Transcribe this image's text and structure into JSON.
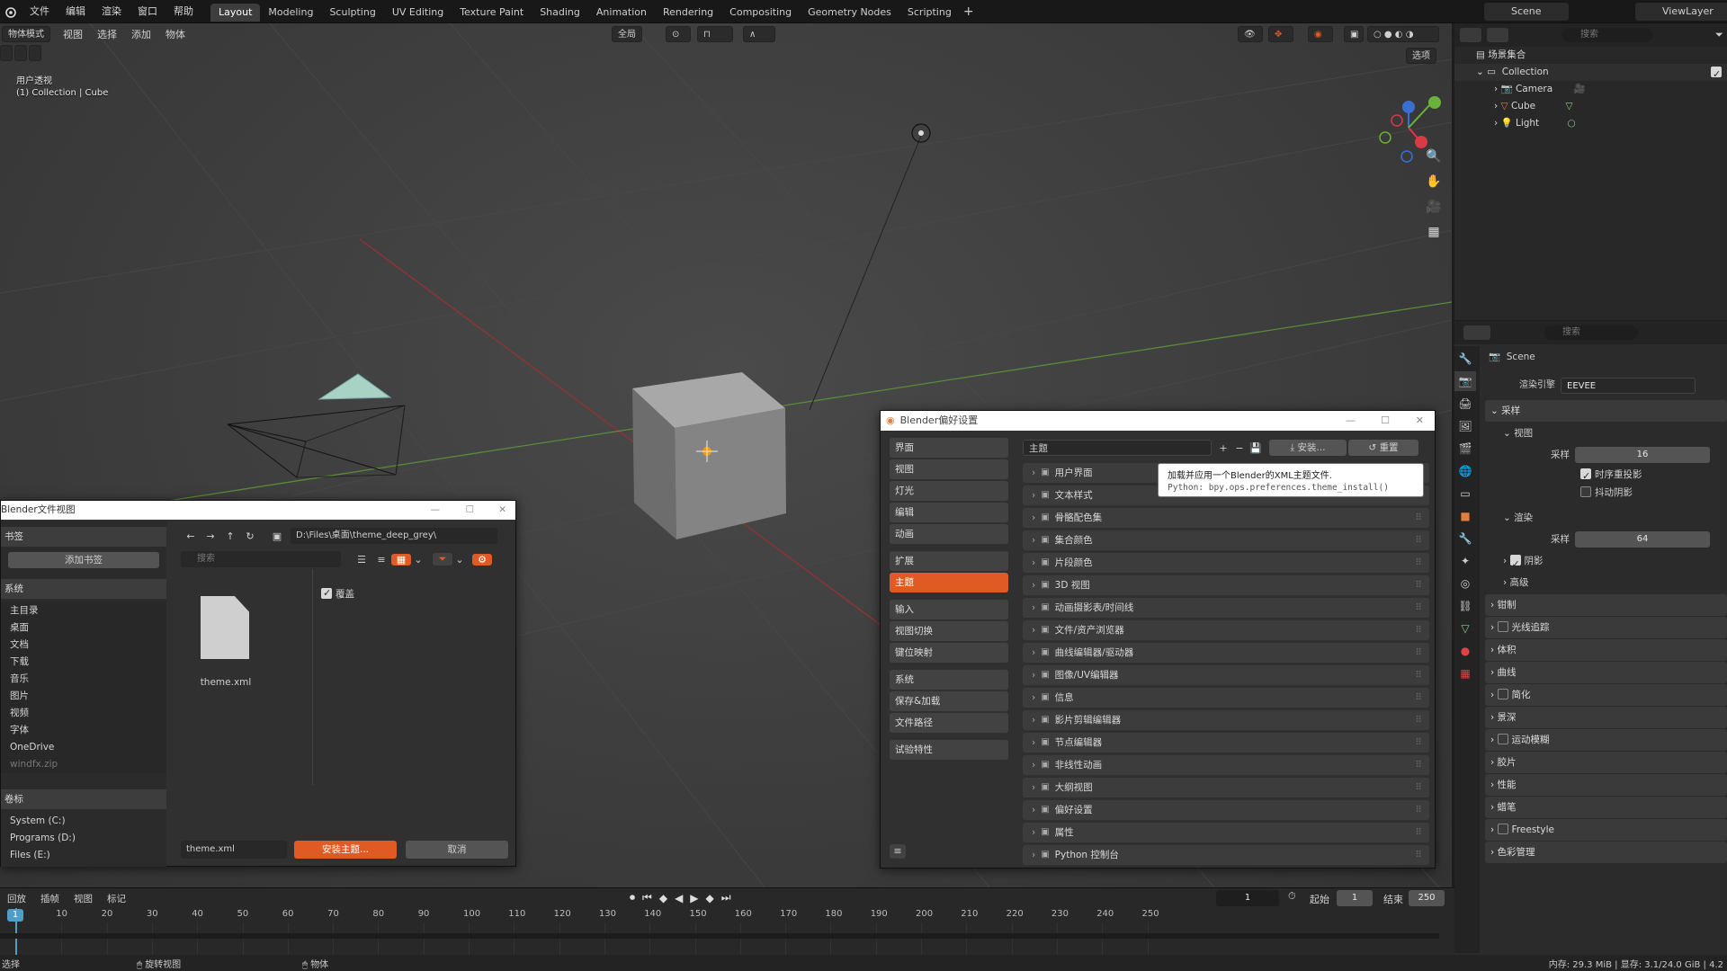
{
  "topbar": {
    "menus": [
      "文件",
      "编辑",
      "渲染",
      "窗口",
      "帮助"
    ],
    "workspaces": [
      "Layout",
      "Modeling",
      "Sculpting",
      "UV Editing",
      "Texture Paint",
      "Shading",
      "Animation",
      "Rendering",
      "Compositing",
      "Geometry Nodes",
      "Scripting"
    ],
    "active_workspace": "Layout",
    "scene": "Scene",
    "view_layer": "ViewLayer"
  },
  "viewport": {
    "mode": "物体模式",
    "menus": [
      "视图",
      "选择",
      "添加",
      "物体"
    ],
    "transform_orient": "全局",
    "options_label": "选项",
    "overlay_line1": "用户透视",
    "overlay_line2": "(1) Collection | Cube"
  },
  "outliner": {
    "search_placeholder": "搜索",
    "root": "场景集合",
    "collection": "Collection",
    "items": [
      "Camera",
      "Cube",
      "Light"
    ]
  },
  "properties": {
    "search_placeholder": "搜索",
    "scene_name": "Scene",
    "render_engine_label": "渲染引擎",
    "render_engine": "EEVEE",
    "sampling": "采样",
    "viewport_sub": "视图",
    "samples_label": "采样",
    "viewport_samples": "16",
    "temporal_reprojection": "时序重投影",
    "jitter_shadows": "抖动阴影",
    "render_sub": "渲染",
    "render_samples": "64",
    "shadows": "阴影",
    "advanced": "高级",
    "sections": [
      "钳制",
      "光线追踪",
      "体积",
      "曲线",
      "简化",
      "景深",
      "运动模糊",
      "胶片",
      "性能",
      "蜡笔",
      "Freestyle",
      "色彩管理"
    ]
  },
  "prefs": {
    "title": "Blender偏好设置",
    "nav_groups": [
      [
        "界面",
        "视图",
        "灯光",
        "编辑",
        "动画"
      ],
      [
        "扩展",
        "主题"
      ],
      [
        "输入",
        "视图切换",
        "键位映射"
      ],
      [
        "系统",
        "保存&加载",
        "文件路径"
      ],
      [
        "试验特性"
      ]
    ],
    "active_nav": "主题",
    "preset_label": "主题",
    "install_label": "安装...",
    "reset_label": "重置",
    "tooltip_line1": "加载并应用一个Blender的XML主题文件.",
    "tooltip_line2": "Python: bpy.ops.preferences.theme_install()",
    "theme_items": [
      "用户界面",
      "文本样式",
      "骨骼配色集",
      "集合颜色",
      "片段颜色",
      "3D 视图",
      "动画摄影表/时间线",
      "文件/资产浏览器",
      "曲线编辑器/驱动器",
      "图像/UV编辑器",
      "信息",
      "影片剪辑编辑器",
      "节点编辑器",
      "非线性动画",
      "大纲视图",
      "偏好设置",
      "属性",
      "Python 控制台"
    ]
  },
  "fileview": {
    "title": "Blender文件视图",
    "bookmarks_head": "书签",
    "add_bookmark": "添加书签",
    "system_head": "系统",
    "system_items": [
      "主目录",
      "桌面",
      "文档",
      "下载",
      "音乐",
      "图片",
      "视频",
      "字体",
      "OneDrive",
      "windfx.zip"
    ],
    "volumes_head": "卷标",
    "volume_items": [
      "System (C:)",
      "Programs (D:)",
      "Files (E:)"
    ],
    "path": "D:\\Files\\桌面\\theme_deep_grey\\",
    "search_placeholder": "搜索",
    "overwrite_label": "覆盖",
    "file_name": "theme.xml",
    "filename_field": "theme.xml",
    "install_button": "安装主题...",
    "cancel_button": "取消"
  },
  "timeline": {
    "menus": [
      "回放",
      "插帧",
      "视图",
      "标记"
    ],
    "current_frame": "1",
    "start_label": "起始",
    "start": "1",
    "end_label": "结束",
    "end": "250",
    "ticks": [
      "10",
      "20",
      "30",
      "40",
      "50",
      "60",
      "70",
      "80",
      "90",
      "100",
      "110",
      "120",
      "130",
      "140",
      "150",
      "160",
      "170",
      "180",
      "190",
      "200",
      "210",
      "220",
      "230",
      "240",
      "250"
    ]
  },
  "statusbar": {
    "left": "选择",
    "mid1": "旋转视图",
    "mid2": "物体",
    "right": "内存: 29.3 MiB | 显存: 3.1/24.0 GiB | 4.2"
  }
}
